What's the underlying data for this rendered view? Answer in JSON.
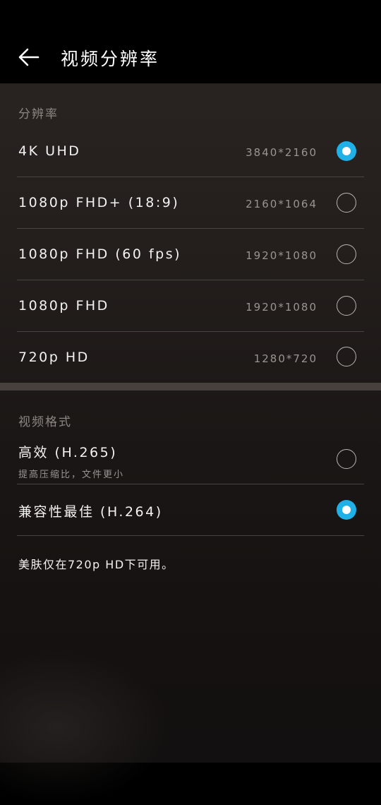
{
  "header": {
    "title": "视频分辨率",
    "back_icon": "arrow-left-icon"
  },
  "resolution_section": {
    "label": "分辨率",
    "options": [
      {
        "label": "4K UHD",
        "value": "3840*2160",
        "selected": true
      },
      {
        "label": "1080p FHD+ (18:9)",
        "value": "2160*1064",
        "selected": false
      },
      {
        "label": "1080p FHD (60 fps)",
        "value": "1920*1080",
        "selected": false
      },
      {
        "label": "1080p FHD",
        "value": "1920*1080",
        "selected": false
      },
      {
        "label": "720p HD",
        "value": "1280*720",
        "selected": false
      }
    ]
  },
  "format_section": {
    "label": "视频格式",
    "options": [
      {
        "label": "高效 (H.265)",
        "sublabel": "提高压缩比，文件更小",
        "selected": false
      },
      {
        "label": "兼容性最佳 (H.264)",
        "selected": true
      }
    ]
  },
  "note": "美肤仅在720p HD下可用。",
  "colors": {
    "accent": "#1fb0e8",
    "header_bg": "#000000",
    "text_primary": "#f2f2f2",
    "text_secondary": "#9a9491"
  }
}
